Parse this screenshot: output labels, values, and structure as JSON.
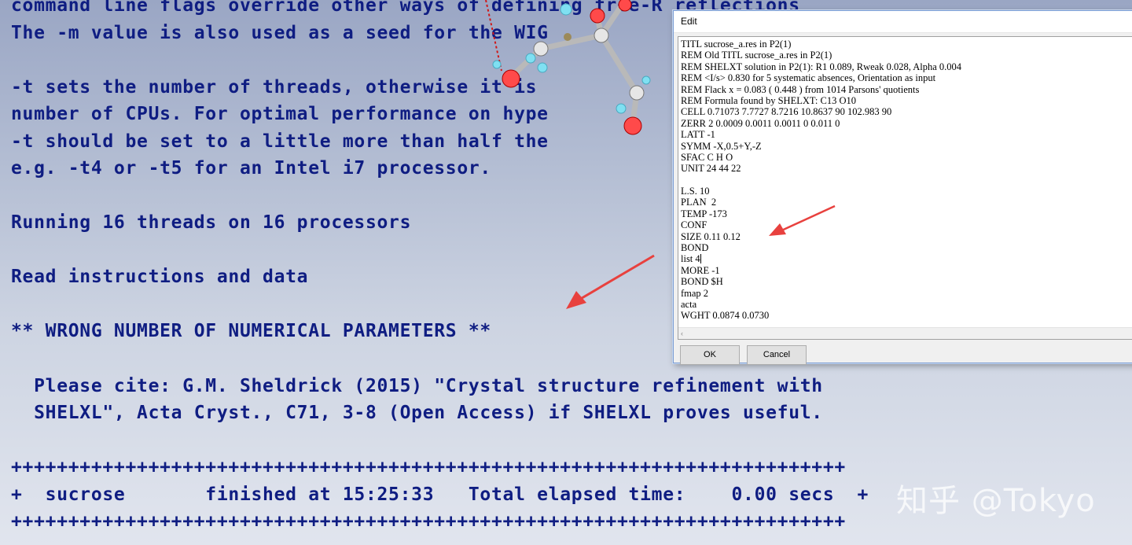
{
  "console": {
    "lines": [
      "command line flags override other ways of defining free-R reflections",
      "The -m value is also used as a seed for the WIG",
      "-t sets the number of threads, otherwise it is",
      "number of CPUs. For optimal performance on hype",
      "-t should be set to a little more than half the",
      "e.g. -t4 or -t5 for an Intel i7 processor.",
      "Running 16 threads on 16 processors",
      "Read instructions and data",
      "** WRONG NUMBER OF NUMERICAL PARAMETERS **",
      "  Please cite: G.M. Sheldrick (2015) \"Crystal structure refinement with",
      "  SHELXL\", Acta Cryst., C71, 3-8 (Open Access) if SHELXL proves useful.",
      "+++++++++++++++++++++++++++++++++++++++++++++++++++++++++++++++++++++++++",
      "+  sucrose       finished at 15:25:33   Total elapsed time:    0.00 secs  +",
      "+++++++++++++++++++++++++++++++++++++++++++++++++++++++++++++++++++++++++"
    ]
  },
  "watermark": "知乎 @Tokyo",
  "dialog": {
    "title": "Edit",
    "editor_lines": [
      "TITL sucrose_a.res in P2(1)",
      "REM Old TITL sucrose_a.res in P2(1)",
      "REM SHELXT solution in P2(1): R1 0.089, Rweak 0.028, Alpha 0.004",
      "REM <I/s> 0.830 for 5 systematic absences, Orientation as input",
      "REM Flack x = 0.083 ( 0.448 ) from 1014 Parsons' quotients",
      "REM Formula found by SHELXT: C13 O10",
      "CELL 0.71073 7.7727 8.7216 10.8637 90 102.983 90",
      "ZERR 2 0.0009 0.0011 0.0011 0 0.011 0",
      "LATT -1",
      "SYMM -X,0.5+Y,-Z",
      "SFAC C H O",
      "UNIT 24 44 22",
      "",
      "L.S. 10",
      "PLAN  2",
      "TEMP -173",
      "CONF",
      "SIZE 0.11 0.12",
      "BOND",
      "list 4",
      "MORE -1",
      "BOND $H",
      "fmap 2",
      "acta",
      "WGHT 0.0874 0.0730"
    ],
    "ok_label": "OK",
    "cancel_label": "Cancel"
  },
  "colors": {
    "console_text": "#0f1d82",
    "arrow": "#e8413e",
    "background_top": "#9aa6c4"
  }
}
